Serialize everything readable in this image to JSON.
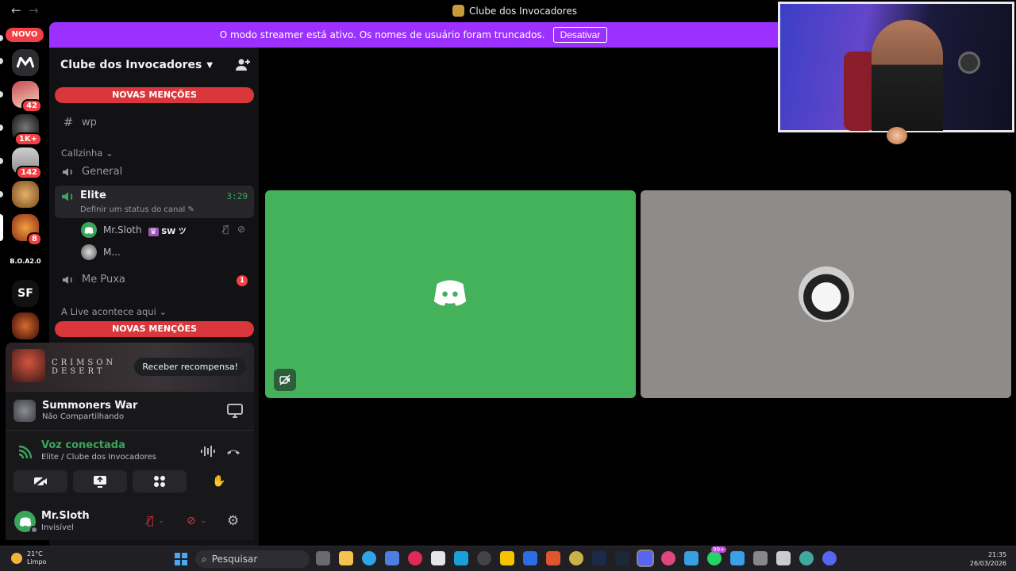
{
  "window": {
    "title": "Clube dos Invocadores",
    "back_arrow": "←",
    "forward_arrow": "→"
  },
  "rail": {
    "novo_label": "NOVO",
    "servers": [
      {
        "name": "server-mv",
        "badge": ""
      },
      {
        "name": "server-2",
        "badge": "42"
      },
      {
        "name": "server-3",
        "badge": "1K+"
      },
      {
        "name": "server-4",
        "badge": "142"
      },
      {
        "name": "server-5",
        "badge": ""
      },
      {
        "name": "server-6",
        "badge": "8"
      },
      {
        "name": "server-boa",
        "label": "B.O.A2.0"
      },
      {
        "name": "server-sf",
        "label": "SF"
      },
      {
        "name": "server-9",
        "badge": ""
      }
    ]
  },
  "banner": {
    "text": "O modo streamer está ativo. Os nomes de usuário foram truncados.",
    "button": "Desativar"
  },
  "sidebar": {
    "guild_name": "Clube dos Invocadores",
    "mentions_label": "NOVAS MENÇÕES",
    "channels": {
      "wp": "wp",
      "category_callzinha": "Callzinha",
      "general": "General",
      "elite": "Elite",
      "elite_time": "3:29",
      "elite_status": "Definir um status do canal",
      "voice_user_1": "Mr.Sloth",
      "voice_user_1_tag": "SW ツ",
      "voice_user_2": "M...",
      "me_puxa": "Me Puxa",
      "me_puxa_unread": "1",
      "category_live": "A Live acontece aqui"
    }
  },
  "promo": {
    "title": "CRIMSON DESERT",
    "button": "Receber recompensa!"
  },
  "activity": {
    "title": "Summoners War",
    "subtitle": "Não Compartilhando"
  },
  "voice": {
    "title": "Voz conectada",
    "subtitle": "Elite / Clube dos Invocadores"
  },
  "user": {
    "name": "Mr.Sloth",
    "status": "Invisível"
  },
  "taskbar": {
    "temperature": "21°C",
    "weather": "Limpo",
    "search_placeholder": "Pesquisar",
    "time": "21:35",
    "date": "26/03/2026",
    "badge": "99+"
  },
  "colors": {
    "banner": "#9b30ff",
    "mentions": "#da373c",
    "voice_green": "#3ba55c",
    "tile_green": "#43b25a",
    "tile_gray": "#8e8b88"
  }
}
